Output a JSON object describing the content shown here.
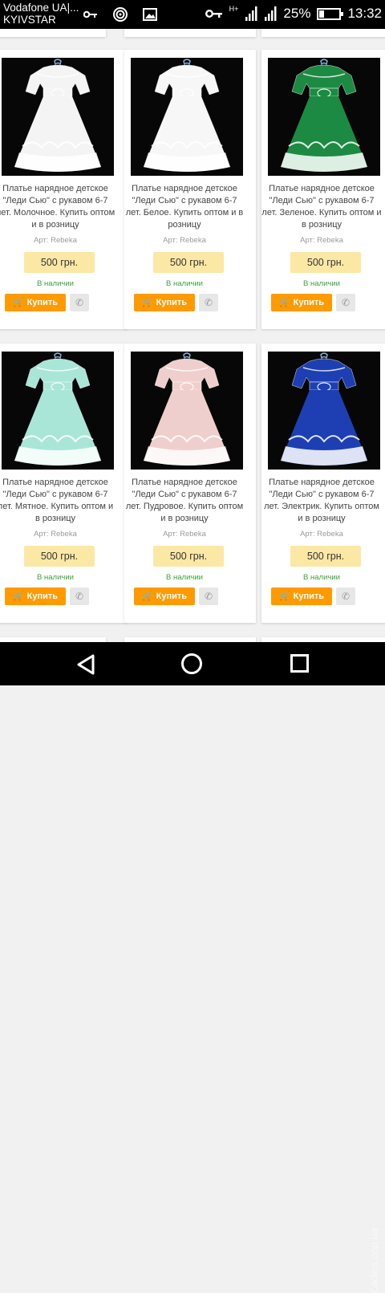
{
  "status_bar": {
    "carrier_line1": "Vodafone UA|...",
    "carrier_line2": "KYIVSTAR",
    "battery_percent": "25%",
    "battery_level": 0.25,
    "time": "13:32",
    "network_badge": "H+",
    "icons": [
      "key-icon",
      "wifi-hotspot-icon",
      "image-icon",
      "key-icon",
      "signal-icon",
      "signal-icon",
      "battery-icon"
    ]
  },
  "products": [
    {
      "title": "Платье нарядное детское \"Леди Сью\" с рукавом 6-7 лет. Молочное. Купить оптом и в розницу",
      "art": "Арт: Rebeka",
      "price": "500 грн.",
      "stock": "В наличии",
      "buy_label": "Купить",
      "dress_color": "#f4f4f4",
      "accent_color": "#f4f4f4"
    },
    {
      "title": "Платье нарядное детское \"Леди Сью\" с рукавом 6-7 лет. Белое. Купить оптом и в розницу",
      "art": "Арт: Rebeka",
      "price": "500 грн.",
      "stock": "В наличии",
      "buy_label": "Купить",
      "dress_color": "#f7f7f7",
      "accent_color": "#f7f7f7"
    },
    {
      "title": "Платье нарядное детское \"Леди Сью\" с рукавом 6-7 лет. Зеленое. Купить оптом и в розницу",
      "art": "Арт: Rebeka",
      "price": "500 грн.",
      "stock": "В наличии",
      "buy_label": "Купить",
      "dress_color": "#1c8a43",
      "accent_color": "#1c8a43"
    },
    {
      "title": "Платье нарядное детское \"Леди Сью\" с рукавом 6-7 лет. Мятное. Купить оптом и в розницу",
      "art": "Арт: Rebeka",
      "price": "500 грн.",
      "stock": "В наличии",
      "buy_label": "Купить",
      "dress_color": "#a9e6d8",
      "accent_color": "#a9e6d8"
    },
    {
      "title": "Платье нарядное детское \"Леди Сью\" с рукавом 6-7 лет. Пудровое. Купить оптом и в розницу",
      "art": "Арт: Rebeka",
      "price": "500 грн.",
      "stock": "В наличии",
      "buy_label": "Купить",
      "dress_color": "#efcfcd",
      "accent_color": "#efcfcd"
    },
    {
      "title": "Платье нарядное детское \"Леди Сью\" с рукавом 6-7 лет. Электрик. Купить оптом и в розницу",
      "art": "Арт: Rebeka",
      "price": "500 грн.",
      "stock": "В наличии",
      "buy_label": "Купить",
      "dress_color": "#1d3fb3",
      "accent_color": "#1d3fb3"
    }
  ],
  "watermark": "Ladies.cop.ua",
  "navigation": {
    "icons": [
      "back-icon",
      "home-icon",
      "recent-apps-icon"
    ]
  },
  "colors": {
    "buy_button": "#ff9a00",
    "price_bg": "#fbe8a5",
    "in_stock": "#39a33a"
  }
}
